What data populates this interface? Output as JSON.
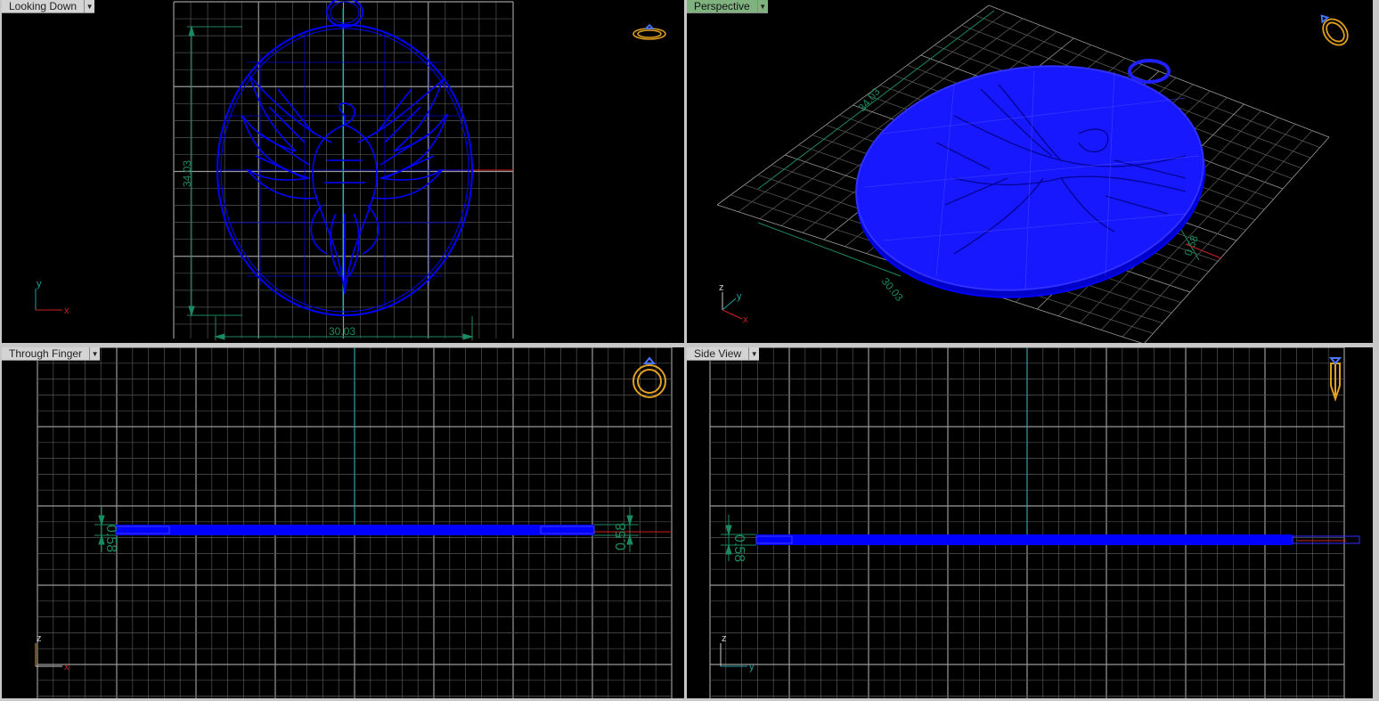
{
  "viewports": {
    "top": {
      "label": "Looking Down",
      "dims": {
        "height": "34.03",
        "width": "30.03"
      },
      "axes": {
        "vertical": "y",
        "horizontal": "x"
      }
    },
    "perspective": {
      "label": "Perspective",
      "dims": {
        "a": "34.03",
        "b": "30.03",
        "c": "0.58"
      },
      "axes": {
        "vertical": "z",
        "depth": "y",
        "horizontal": "x"
      }
    },
    "front": {
      "label": "Through Finger",
      "dims": {
        "left": "0.58",
        "right": "0.58"
      },
      "axes": {
        "vertical": "z",
        "horizontal": "x"
      }
    },
    "side": {
      "label": "Side View",
      "dims": {
        "left": "0.58"
      },
      "axes": {
        "vertical": "z",
        "horizontal": "y"
      }
    }
  },
  "colors": {
    "model": "#0000ff",
    "grid": "#6a6a6a",
    "dimension": "#1a8a60",
    "ring": "#e0a020",
    "axisRed": "#cc2020",
    "cyan": "#20a0a0"
  },
  "icons": {
    "view_cube": "ring-icon"
  }
}
